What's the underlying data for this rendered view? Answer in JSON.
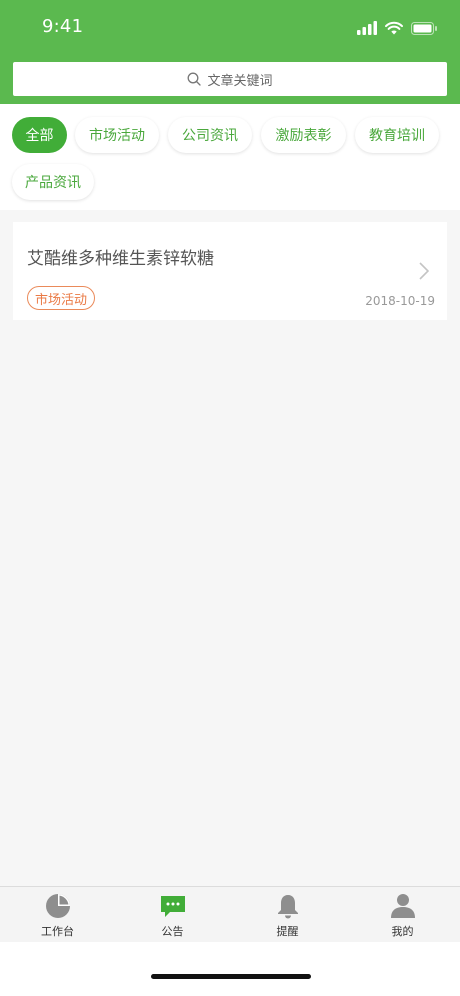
{
  "status_bar": {
    "time": "9:41"
  },
  "search": {
    "placeholder": "文章关键词"
  },
  "categories": [
    {
      "label": "全部",
      "active": true
    },
    {
      "label": "市场活动",
      "active": false
    },
    {
      "label": "公司资讯",
      "active": false
    },
    {
      "label": "激励表彰",
      "active": false
    },
    {
      "label": "教育培训",
      "active": false
    },
    {
      "label": "产品资讯",
      "active": false
    }
  ],
  "articles": [
    {
      "title": "艾酷维多种维生素锌软糖",
      "tag": "市场活动",
      "date": "2018-10-19"
    }
  ],
  "tabbar": [
    {
      "label": "工作台",
      "icon": "pie-chart-icon"
    },
    {
      "label": "公告",
      "icon": "message-icon",
      "active": true
    },
    {
      "label": "提醒",
      "icon": "bell-icon"
    },
    {
      "label": "我的",
      "icon": "user-icon"
    }
  ],
  "colors": {
    "brand": "#5bb94f",
    "active_chip": "#41ad38",
    "tag": "#ea7a45"
  }
}
